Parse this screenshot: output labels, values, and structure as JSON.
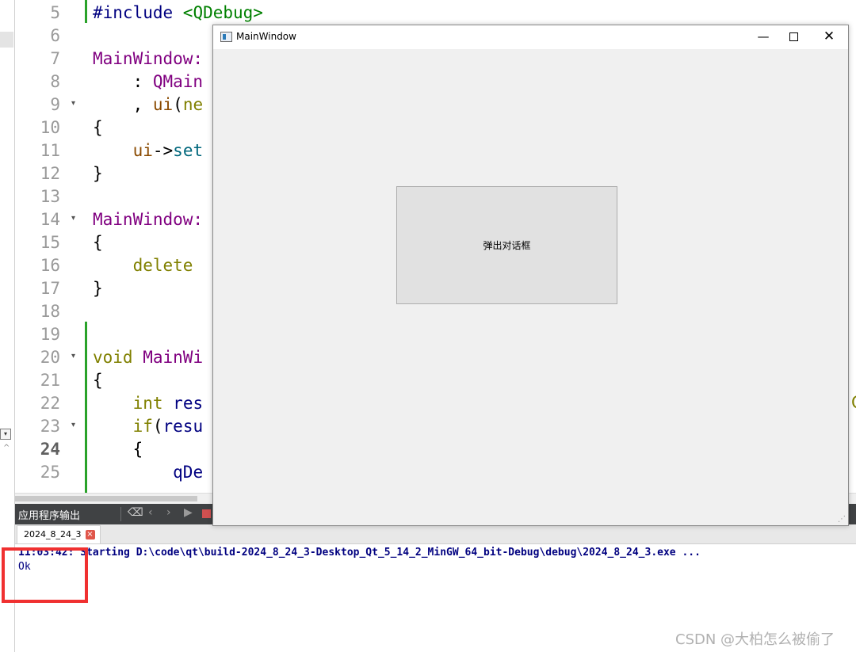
{
  "editor": {
    "lines": [
      {
        "no": "5",
        "segments": [
          {
            "t": "#include ",
            "c": "kw-navy"
          },
          {
            "t": "<QDebug>",
            "c": "kw-green"
          }
        ]
      },
      {
        "no": "6",
        "segments": []
      },
      {
        "no": "7",
        "segments": [
          {
            "t": "MainWindow:",
            "c": "kw-purple"
          }
        ]
      },
      {
        "no": "8",
        "segments": [
          {
            "t": "    : ",
            "c": ""
          },
          {
            "t": "QMain",
            "c": "kw-purple"
          }
        ]
      },
      {
        "no": "9",
        "segments": [
          {
            "t": "    , ",
            "c": ""
          },
          {
            "t": "ui",
            "c": "kw-brown"
          },
          {
            "t": "(",
            "c": ""
          },
          {
            "t": "ne",
            "c": "kw-olive"
          }
        ],
        "fold": true
      },
      {
        "no": "10",
        "segments": [
          {
            "t": "{",
            "c": ""
          }
        ]
      },
      {
        "no": "11",
        "segments": [
          {
            "t": "    ",
            "c": ""
          },
          {
            "t": "ui",
            "c": "kw-brown"
          },
          {
            "t": "->",
            "c": ""
          },
          {
            "t": "set",
            "c": "kw-teal"
          }
        ]
      },
      {
        "no": "12",
        "segments": [
          {
            "t": "}",
            "c": ""
          }
        ]
      },
      {
        "no": "13",
        "segments": []
      },
      {
        "no": "14",
        "segments": [
          {
            "t": "MainWindow:",
            "c": "kw-purple"
          }
        ],
        "fold": true
      },
      {
        "no": "15",
        "segments": [
          {
            "t": "{",
            "c": ""
          }
        ]
      },
      {
        "no": "16",
        "segments": [
          {
            "t": "    ",
            "c": ""
          },
          {
            "t": "delete",
            "c": "kw-olive"
          }
        ]
      },
      {
        "no": "17",
        "segments": [
          {
            "t": "}",
            "c": ""
          }
        ]
      },
      {
        "no": "18",
        "segments": []
      },
      {
        "no": "19",
        "segments": []
      },
      {
        "no": "20",
        "segments": [
          {
            "t": "void",
            "c": "kw-olive"
          },
          {
            "t": " ",
            "c": ""
          },
          {
            "t": "MainWi",
            "c": "kw-purple"
          }
        ],
        "fold": true
      },
      {
        "no": "21",
        "segments": [
          {
            "t": "{",
            "c": ""
          }
        ]
      },
      {
        "no": "22",
        "segments": [
          {
            "t": "    ",
            "c": ""
          },
          {
            "t": "int",
            "c": "kw-olive"
          },
          {
            "t": " ",
            "c": ""
          },
          {
            "t": "res",
            "c": "kw-navy"
          }
        ]
      },
      {
        "no": "23",
        "segments": [
          {
            "t": "    ",
            "c": ""
          },
          {
            "t": "if",
            "c": "kw-olive"
          },
          {
            "t": "(",
            "c": ""
          },
          {
            "t": "resu",
            "c": "kw-navy"
          }
        ],
        "fold": true
      },
      {
        "no": "24",
        "segments": [
          {
            "t": "    {",
            "c": ""
          }
        ],
        "current": true
      },
      {
        "no": "25",
        "segments": [
          {
            "t": "        ",
            "c": ""
          },
          {
            "t": "qDe",
            "c": "kw-navy"
          }
        ]
      }
    ],
    "peek_right": "Q"
  },
  "output": {
    "title": "应用程序输出",
    "tab_label": "2024_8_24_3",
    "tab_close": "×",
    "line1": "11:03:42: Starting D:\\code\\qt\\build-2024_8_24_3-Desktop_Qt_5_14_2_MinGW_64_bit-Debug\\debug\\2024_8_24_3.exe ...",
    "line2": "Ok"
  },
  "window": {
    "title": "MainWindow",
    "minimize": "—",
    "close": "✕",
    "button_label": "弹出对话框"
  },
  "watermark": "CSDN @大柏怎么被偷了"
}
